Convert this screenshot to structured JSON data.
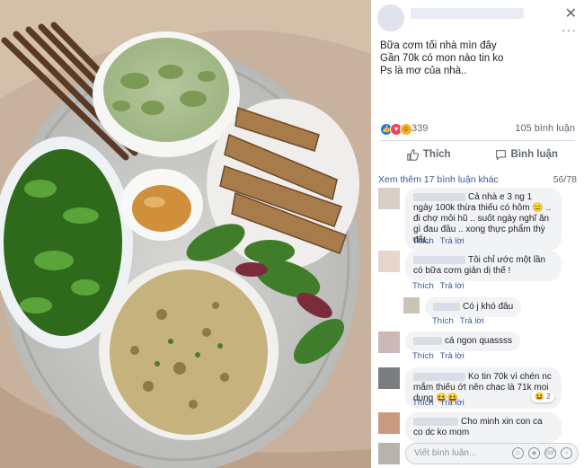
{
  "post": {
    "caption_lines": [
      "Bữa cơm tối nhà mìn đây",
      "Gần 70k có mon nào tin ko",
      "Ps là mơ của nhà.."
    ],
    "reaction_count": "339",
    "comment_count": "105 bình luận",
    "actions": {
      "like": "Thích",
      "comment": "Bình luận"
    }
  },
  "comments_section": {
    "view_more": "Xem thêm 17 bình luận khác",
    "counter": "56/78",
    "comments": [
      {
        "text": "Cả nhà e 3 ng 1 ngày 100k thừa thiếu có hôm 😑 .. đi chợ mỏi hũ .. suốt ngày nghĩ ăn gì đau đầu .. xong thực phẩm thỳ đắt..",
        "like": "Thích",
        "reply": "Trả lời"
      },
      {
        "text": "Tôi chỉ ước một lần có bữa cơm giản dị thế !",
        "like": "Thích",
        "reply": "Trả lời"
      },
      {
        "text": "Có j khó đâu",
        "like": "Thích",
        "reply": "Trả lời"
      },
      {
        "text": "cá ngon quassss",
        "like": "Thích",
        "reply": "Trả lời"
      },
      {
        "text": "Ko tin 70k vì chén nc mắm thiếu ớt nên chac là 71k moi dung 😆😆",
        "like": "Thích",
        "reply": "Trả lời",
        "reactions": "2"
      },
      {
        "text": "Cho minh xin con ca co dc ko mom"
      }
    ],
    "input_placeholder": "Viết bình luận..."
  },
  "colors": {
    "link": "#385898",
    "like_blue": "#1877f2",
    "bubble": "#f2f3f5"
  }
}
